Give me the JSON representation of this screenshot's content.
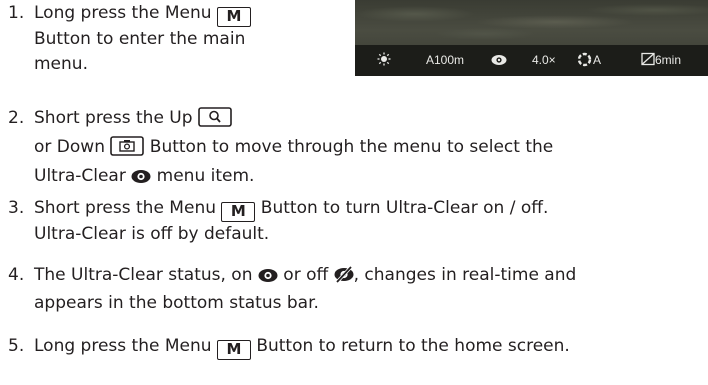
{
  "device_screen": {
    "status_bar": {
      "brightness_icon": "sun-icon",
      "range": "A100m",
      "ultra_clear_icon": "eye-icon",
      "zoom": "4.0×",
      "auto_icon": "auto-mode-icon",
      "auto_label": "A",
      "sleep_icon": "sleep-timer-icon",
      "sleep": "6min"
    }
  },
  "button_labels": {
    "menu": "M"
  },
  "steps": [
    {
      "number": "1.",
      "line1a": "Long press the Menu ",
      "line1b": "",
      "line2": "Button to enter the main",
      "line3": "menu."
    },
    {
      "number": "2.",
      "line1": "Short press the Up ",
      "line2a": "or Down ",
      "line2b": " Button to move through the menu to select the",
      "line3a": "Ultra-Clear ",
      "line3b": " menu item."
    },
    {
      "number": "3.",
      "line1a": "Short press the Menu ",
      "line1b": " Button to turn Ultra-Clear on / off.",
      "line2": "Ultra-Clear is off by default."
    },
    {
      "number": "4.",
      "line1a": "The Ultra-Clear status, on ",
      "line1b": " or off ",
      "line1c": ", changes in real-time and",
      "line2": "appears in the bottom status bar."
    },
    {
      "number": "5.",
      "line1a": "Long press the Menu ",
      "line1b": " Button to return to the home screen."
    }
  ]
}
